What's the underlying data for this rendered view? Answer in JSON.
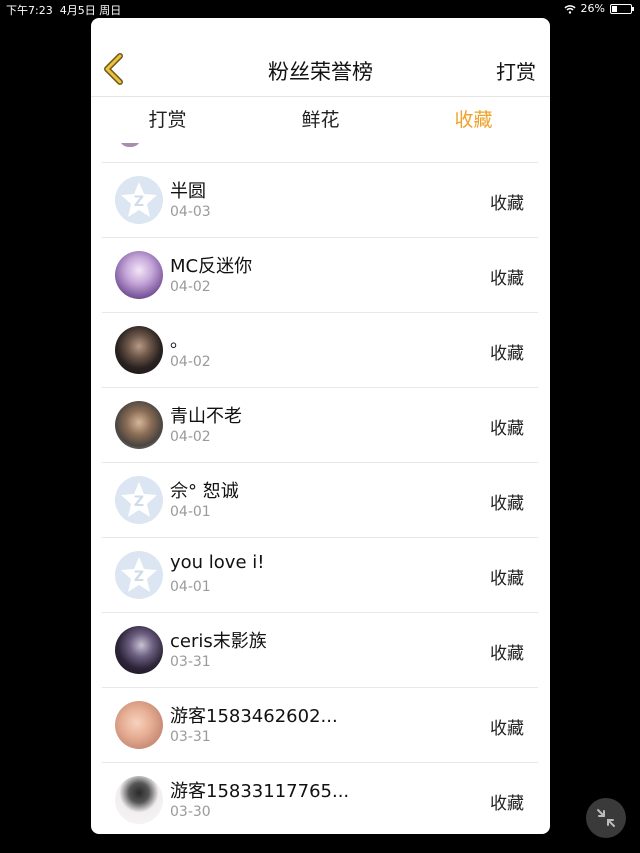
{
  "status_bar": {
    "time": "下午7:23",
    "date": "4月5日 周日",
    "battery": "26%",
    "battery_level": 0.26
  },
  "header": {
    "title": "粉丝荣誉榜",
    "action": "打赏"
  },
  "tabs": [
    {
      "label": "打赏",
      "active": false
    },
    {
      "label": "鲜花",
      "active": false
    },
    {
      "label": "收藏",
      "active": true
    }
  ],
  "rows": [
    {
      "name": "半圆",
      "date": "04-03",
      "action": "收藏",
      "avatar": "default-star"
    },
    {
      "name": "MC反迷你",
      "date": "04-02",
      "action": "收藏",
      "avatar": "photo-purple"
    },
    {
      "name": "。",
      "date": "04-02",
      "action": "收藏",
      "avatar": "photo-man"
    },
    {
      "name": "青山不老",
      "date": "04-02",
      "action": "收藏",
      "avatar": "photo-man"
    },
    {
      "name": "佘° 恕诚",
      "date": "04-01",
      "action": "收藏",
      "avatar": "default-star"
    },
    {
      "name": "you love i!",
      "date": "04-01",
      "action": "收藏",
      "avatar": "default-star"
    },
    {
      "name": "ceris末影族",
      "date": "03-31",
      "action": "收藏",
      "avatar": "photo-dark"
    },
    {
      "name": "游客1583462602...",
      "date": "03-31",
      "action": "收藏",
      "avatar": "photo-pink"
    },
    {
      "name": "游客15833117765...",
      "date": "03-30",
      "action": "收藏",
      "avatar": "photo-boy"
    }
  ],
  "colors": {
    "accent": "#f0a32b",
    "background": "#000000",
    "panel": "#ffffff"
  },
  "icons": {
    "back": "chevron-left-icon",
    "default_avatar": "star-logo-icon",
    "fab": "collapse-icon"
  }
}
